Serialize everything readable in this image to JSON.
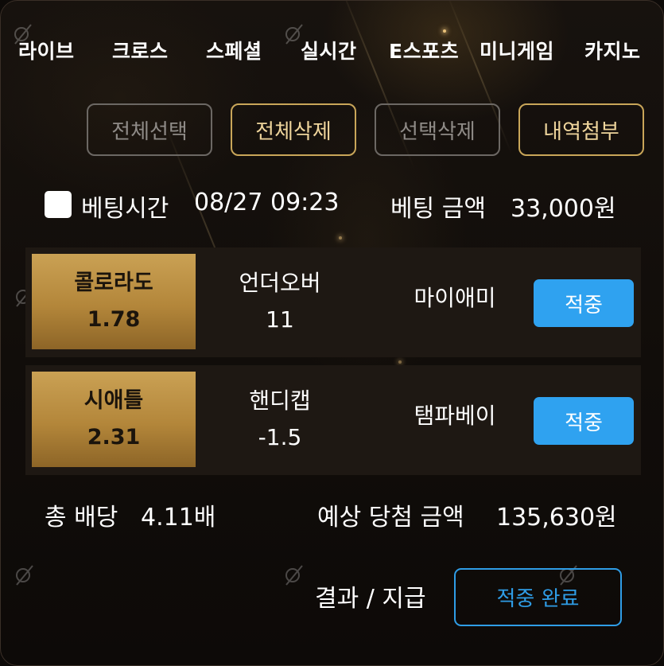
{
  "nav": {
    "items": [
      "라이브",
      "크로스",
      "스페셜",
      "실시간",
      "E스포츠",
      "미니게임",
      "카지노"
    ]
  },
  "actions": {
    "select_all": "전체선택",
    "delete_all": "전체삭제",
    "delete_selected": "선택삭제",
    "attach_history": "내역첨부"
  },
  "meta": {
    "bet_time_label": "베팅시간",
    "bet_time_value": "08/27 09:23",
    "bet_amount_label": "베팅 금액",
    "bet_amount_value": "33,000원"
  },
  "bets": [
    {
      "team": "콜로라도",
      "odds": "1.78",
      "market": "언더오버",
      "line": "11",
      "opponent": "마이애미",
      "status": "적중"
    },
    {
      "team": "시애틀",
      "odds": "2.31",
      "market": "핸디캡",
      "line": "-1.5",
      "opponent": "탬파베이",
      "status": "적중"
    }
  ],
  "summary": {
    "total_odds_label": "총 배당",
    "total_odds_value": "4.11배",
    "expected_win_label": "예상 당첨 금액",
    "expected_win_value": "135,630원"
  },
  "result": {
    "label": "결과 / 지급",
    "status_button": "적중 완료"
  },
  "colors": {
    "gold": "#c9a659",
    "accent_blue": "#2fa2f0",
    "background": "#110d0a"
  }
}
